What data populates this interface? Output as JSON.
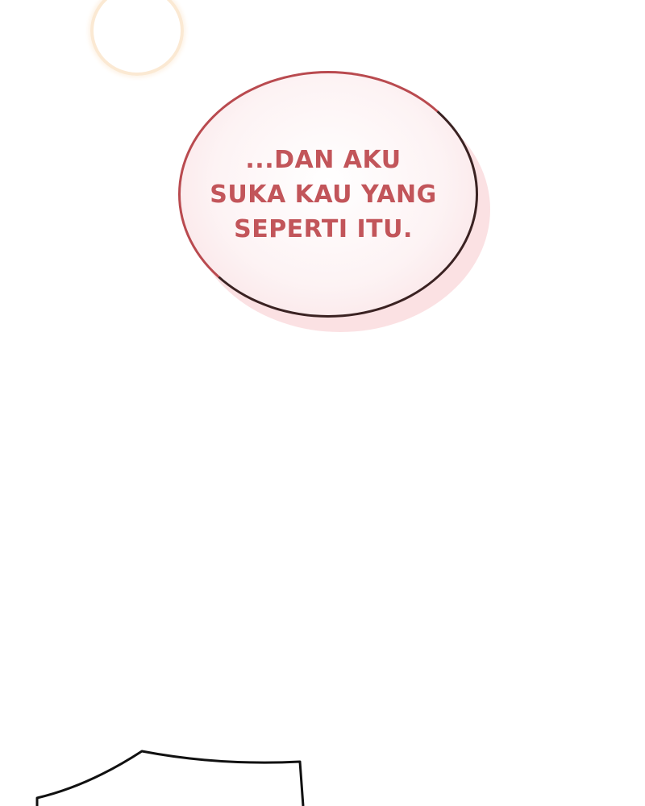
{
  "speech_bubble": {
    "lines": [
      "...DAN AKU",
      "SUKA KAU YANG",
      "SEPERTI ITU."
    ]
  },
  "colors": {
    "background": "#ffffff",
    "text": "#c2555a",
    "bubble_outline": "#b94a4f",
    "bubble_shadow": "#fbe1e3",
    "glow": "#fbe7cf"
  }
}
